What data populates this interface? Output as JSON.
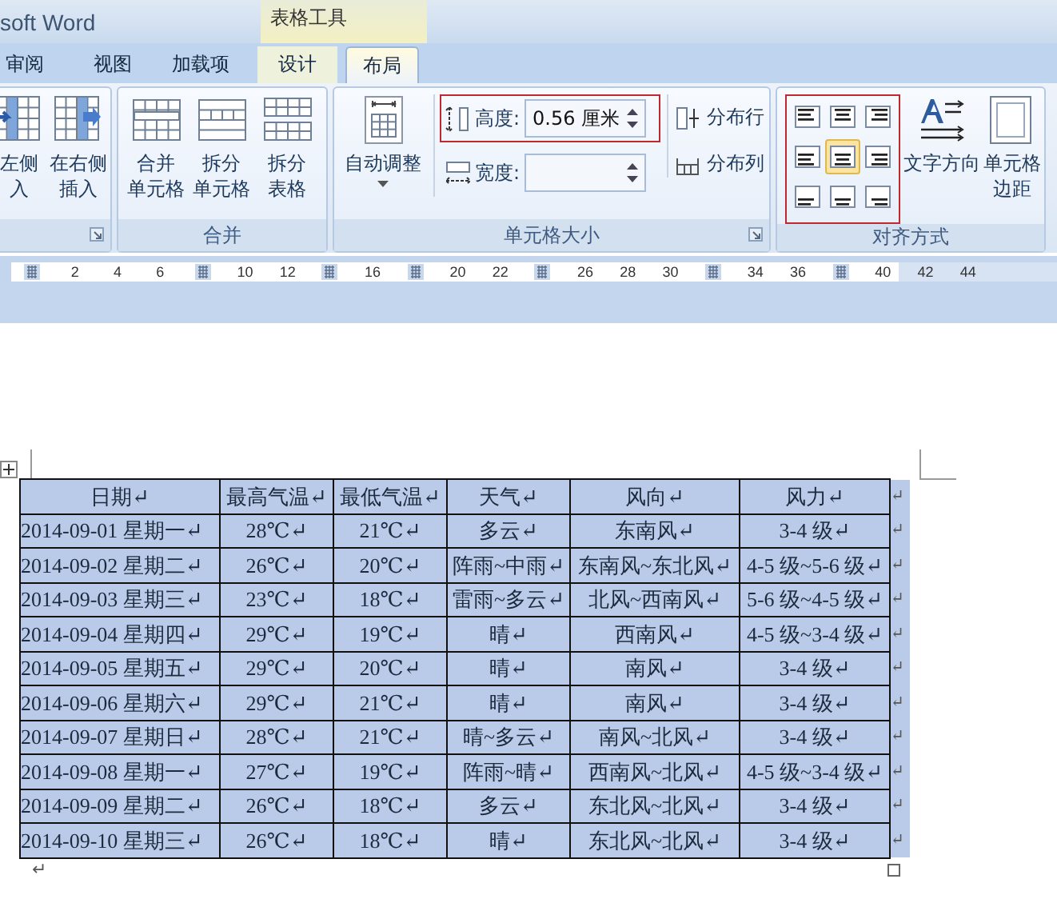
{
  "title_bar": {
    "title": "soft Word",
    "context_label": "表格工具"
  },
  "tabs": [
    {
      "label": "审阅",
      "selected": false,
      "contextual": false
    },
    {
      "label": "视图",
      "selected": false,
      "contextual": false
    },
    {
      "label": "加载项",
      "selected": false,
      "contextual": false
    },
    {
      "label": "设计",
      "selected": false,
      "contextual": true
    },
    {
      "label": "布局",
      "selected": true,
      "contextual": true
    }
  ],
  "insert_group": {
    "launcher": true,
    "buttons": [
      {
        "kind": "insert-left",
        "lines": [
          "左侧",
          "入"
        ]
      },
      {
        "kind": "insert-right",
        "lines": [
          "在右侧",
          "插入"
        ]
      }
    ]
  },
  "merge_group": {
    "label": "合并",
    "buttons": [
      {
        "kind": "merge",
        "lines": [
          "合并",
          "单元格"
        ]
      },
      {
        "kind": "split-cells",
        "lines": [
          "拆分",
          "单元格"
        ]
      },
      {
        "kind": "split-table",
        "lines": [
          "拆分",
          "表格"
        ]
      }
    ]
  },
  "cell_size_group": {
    "label": "单元格大小",
    "launcher": true,
    "autofit": {
      "label": "自动调整",
      "dropdown": true
    },
    "height": {
      "label": "高度:",
      "value": "0.56 厘米",
      "highlighted": true
    },
    "width": {
      "label": "宽度:",
      "highlighted": false
    },
    "distribute": [
      {
        "kind": "rows",
        "label": "分布行"
      },
      {
        "kind": "columns",
        "label": "分布列"
      }
    ]
  },
  "alignment_group": {
    "label": "对齐方式",
    "highlighted": true,
    "align_buttons": [
      {
        "selected": false
      },
      {
        "selected": false
      },
      {
        "selected": false
      },
      {
        "selected": false
      },
      {
        "selected": true
      },
      {
        "selected": false
      },
      {
        "selected": false
      },
      {
        "selected": false
      },
      {
        "selected": false
      }
    ],
    "buttons": [
      {
        "kind": "text-direction",
        "lines": [
          "文字方向"
        ]
      },
      {
        "kind": "cell-margins",
        "lines": [
          "单元格",
          "边距"
        ]
      }
    ]
  },
  "ruler": [
    {
      "kind": "marker"
    },
    {
      "kind": "number",
      "label": "2"
    },
    {
      "kind": "number",
      "label": "4"
    },
    {
      "kind": "number",
      "label": "6"
    },
    {
      "kind": "marker"
    },
    {
      "kind": "number",
      "label": "10"
    },
    {
      "kind": "number",
      "label": "12"
    },
    {
      "kind": "marker"
    },
    {
      "kind": "number",
      "label": "16"
    },
    {
      "kind": "marker"
    },
    {
      "kind": "number",
      "label": "20"
    },
    {
      "kind": "number",
      "label": "22"
    },
    {
      "kind": "marker"
    },
    {
      "kind": "number",
      "label": "26"
    },
    {
      "kind": "number",
      "label": "28"
    },
    {
      "kind": "number",
      "label": "30"
    },
    {
      "kind": "marker"
    },
    {
      "kind": "number",
      "label": "34"
    },
    {
      "kind": "number",
      "label": "36"
    },
    {
      "kind": "marker"
    },
    {
      "kind": "number",
      "label": "40"
    },
    {
      "kind": "number",
      "label": "42"
    },
    {
      "kind": "number",
      "label": "44"
    }
  ],
  "table": {
    "selected": true,
    "header": {
      "cells": [
        "日期↵",
        "最高气温↵",
        "最低气温↵",
        "天气↵",
        "风向↵",
        "风力↵"
      ],
      "end_mark": "↵"
    },
    "rows": [
      {
        "cells": [
          "2014-09-01 星期一↵",
          "28℃↵",
          "21℃↵",
          "多云↵",
          "东南风↵",
          "3-4 级↵"
        ],
        "end_mark": "↵"
      },
      {
        "cells": [
          "2014-09-02 星期二↵",
          "26℃↵",
          "20℃↵",
          "阵雨~中雨↵",
          "东南风~东北风↵",
          "4-5 级~5-6 级↵"
        ],
        "end_mark": "↵"
      },
      {
        "cells": [
          "2014-09-03 星期三↵",
          "23℃↵",
          "18℃↵",
          "雷雨~多云↵",
          "北风~西南风↵",
          "5-6 级~4-5 级↵"
        ],
        "end_mark": "↵"
      },
      {
        "cells": [
          "2014-09-04 星期四↵",
          "29℃↵",
          "19℃↵",
          "晴↵",
          "西南风↵",
          "4-5 级~3-4 级↵"
        ],
        "end_mark": "↵"
      },
      {
        "cells": [
          "2014-09-05 星期五↵",
          "29℃↵",
          "20℃↵",
          "晴↵",
          "南风↵",
          "3-4 级↵"
        ],
        "end_mark": "↵"
      },
      {
        "cells": [
          "2014-09-06 星期六↵",
          "29℃↵",
          "21℃↵",
          "晴↵",
          "南风↵",
          "3-4 级↵"
        ],
        "end_mark": "↵"
      },
      {
        "cells": [
          "2014-09-07 星期日↵",
          "28℃↵",
          "21℃↵",
          "晴~多云↵",
          "南风~北风↵",
          "3-4 级↵"
        ],
        "end_mark": "↵"
      },
      {
        "cells": [
          "2014-09-08 星期一↵",
          "27℃↵",
          "19℃↵",
          "阵雨~晴↵",
          "西南风~北风↵",
          "4-5 级~3-4 级↵"
        ],
        "end_mark": "↵"
      },
      {
        "cells": [
          "2014-09-09 星期二↵",
          "26℃↵",
          "18℃↵",
          "多云↵",
          "东北风~北风↵",
          "3-4 级↵"
        ],
        "end_mark": "↵"
      },
      {
        "cells": [
          "2014-09-10 星期三↵",
          "26℃↵",
          "18℃↵",
          "晴↵",
          "东北风~北风↵",
          "3-4 级↵"
        ],
        "end_mark": "↵"
      }
    ]
  },
  "after_table_mark": "↵"
}
